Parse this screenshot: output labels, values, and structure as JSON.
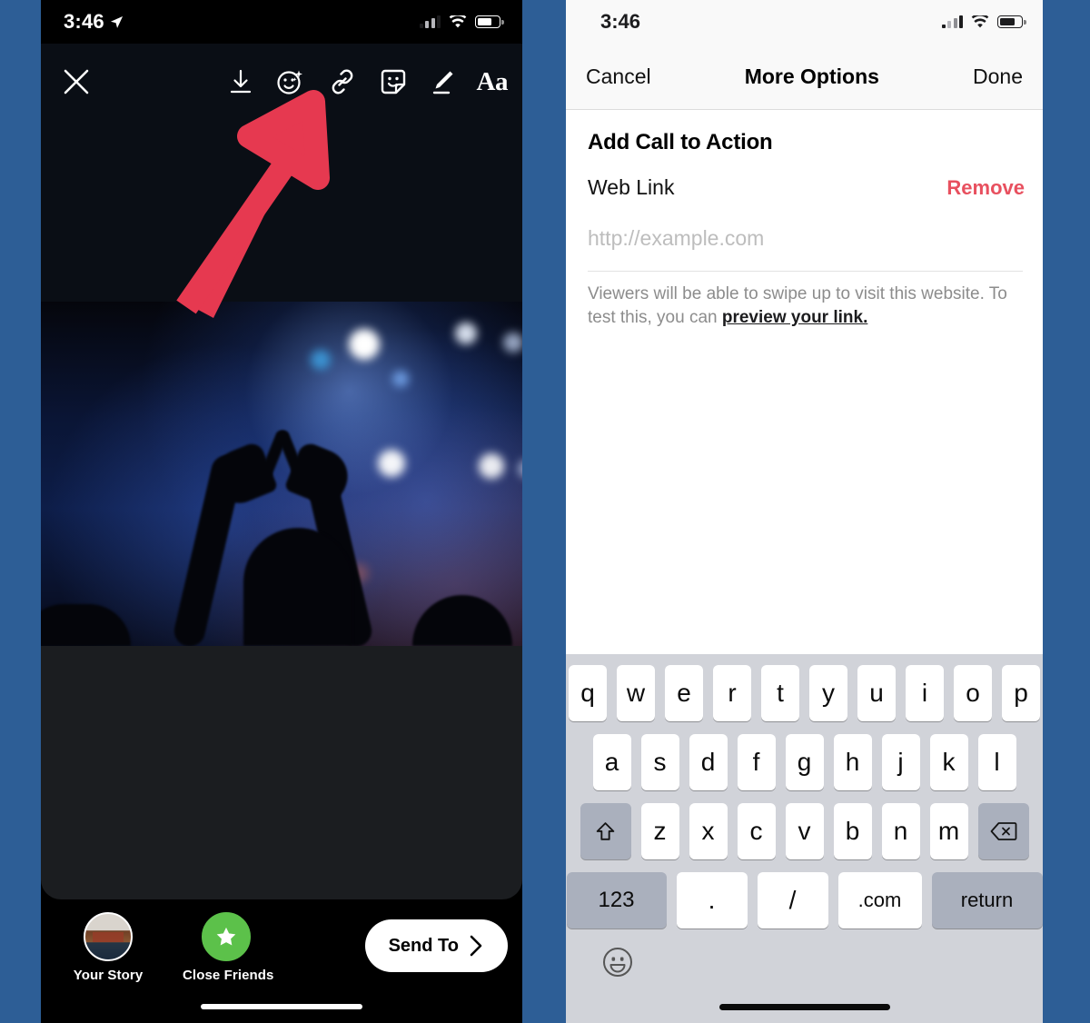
{
  "colors": {
    "page_background": "#2d5e96",
    "annotation_red": "#e63950",
    "remove_red": "#e8505f",
    "close_friends_green": "#5cc14a",
    "keyboard_background": "#d1d3d9",
    "keyboard_modifier": "#aab0bd"
  },
  "left_phone": {
    "status_bar": {
      "time": "3:46",
      "location_icon": "location-arrow-icon",
      "signal_icon": "cellular-signal-icon",
      "wifi_icon": "wifi-icon",
      "battery_icon": "battery-icon"
    },
    "toolbar": {
      "close_icon": "close-icon",
      "items": [
        {
          "name": "save-icon",
          "label": "Save"
        },
        {
          "name": "effects-icon",
          "label": "Effects"
        },
        {
          "name": "link-icon",
          "label": "Link"
        },
        {
          "name": "sticker-icon",
          "label": "Sticker"
        },
        {
          "name": "draw-icon",
          "label": "Draw"
        },
        {
          "name": "text-icon",
          "label": "Aa"
        }
      ]
    },
    "bottom_bar": {
      "targets": [
        {
          "label": "Your Story",
          "icon": "story-avatar"
        },
        {
          "label": "Close Friends",
          "icon": "star-icon"
        }
      ],
      "send_to_label": "Send To",
      "send_to_chevron": "chevron-right-icon"
    },
    "annotation": {
      "type": "arrow",
      "points_to": "link-icon",
      "color": "#e63950"
    }
  },
  "right_phone": {
    "status_bar": {
      "time": "3:46",
      "signal_icon": "cellular-signal-icon",
      "wifi_icon": "wifi-icon",
      "battery_icon": "battery-icon"
    },
    "navbar": {
      "cancel_label": "Cancel",
      "title": "More Options",
      "done_label": "Done"
    },
    "content": {
      "section_title": "Add Call to Action",
      "web_link_label": "Web Link",
      "remove_label": "Remove",
      "url_value": "",
      "url_placeholder": "http://example.com",
      "helper_text_before": "Viewers will be able to swipe up to visit this website. To test this, you can ",
      "helper_link": "preview your link.",
      "helper_text_after": ""
    },
    "keyboard": {
      "row1": [
        "q",
        "w",
        "e",
        "r",
        "t",
        "y",
        "u",
        "i",
        "o",
        "p"
      ],
      "row2": [
        "a",
        "s",
        "d",
        "f",
        "g",
        "h",
        "j",
        "k",
        "l"
      ],
      "row3": [
        "z",
        "x",
        "c",
        "v",
        "b",
        "n",
        "m"
      ],
      "shift_icon": "shift-icon",
      "backspace_icon": "backspace-icon",
      "numbers_label": "123",
      "period_label": ".",
      "slash_label": "/",
      "dotcom_label": ".com",
      "return_label": "return",
      "emoji_icon": "emoji-icon"
    }
  }
}
